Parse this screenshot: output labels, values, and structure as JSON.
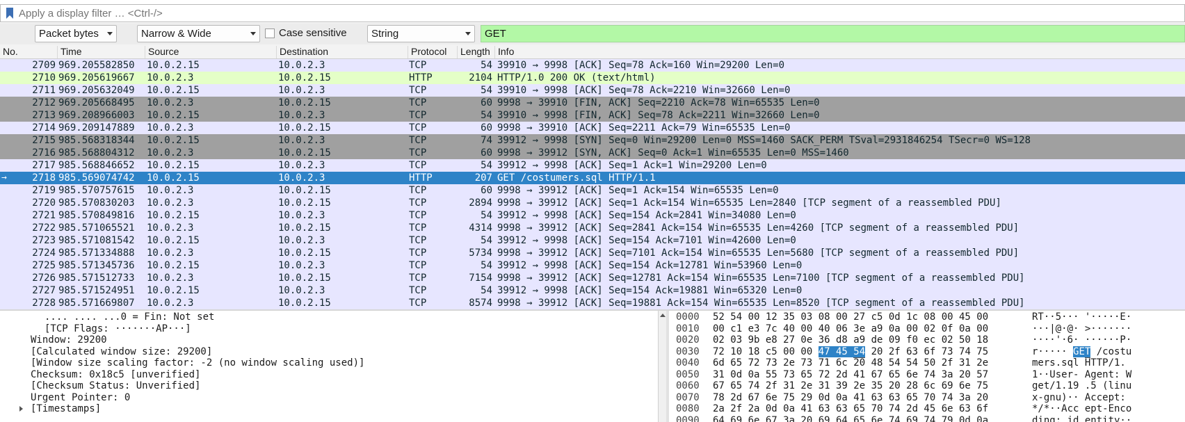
{
  "filter": {
    "placeholder": "Apply a display filter … <Ctrl-/>"
  },
  "find": {
    "search_in": "Packet bytes",
    "char_width": "Narrow & Wide",
    "case_sensitive_label": "Case sensitive",
    "search_type": "String",
    "search_value": "GET"
  },
  "packet_list": {
    "columns": [
      "No.",
      "Time",
      "Source",
      "Destination",
      "Protocol",
      "Length",
      "Info"
    ],
    "rows": [
      {
        "no": "2709",
        "time": "969.205582850",
        "src": "10.0.2.15",
        "dst": "10.0.2.3",
        "proto": "TCP",
        "len": "54",
        "info": "39910 → 9998 [ACK] Seq=78 Ack=160 Win=29200 Len=0",
        "style": "tcp"
      },
      {
        "no": "2710",
        "time": "969.205619667",
        "src": "10.0.2.3",
        "dst": "10.0.2.15",
        "proto": "HTTP",
        "len": "2104",
        "info": "HTTP/1.0 200 OK  (text/html)",
        "style": "http"
      },
      {
        "no": "2711",
        "time": "969.205632049",
        "src": "10.0.2.15",
        "dst": "10.0.2.3",
        "proto": "TCP",
        "len": "54",
        "info": "39910 → 9998 [ACK] Seq=78 Ack=2210 Win=32660 Len=0",
        "style": "tcp"
      },
      {
        "no": "2712",
        "time": "969.205668495",
        "src": "10.0.2.3",
        "dst": "10.0.2.15",
        "proto": "TCP",
        "len": "60",
        "info": "9998 → 39910 [FIN, ACK] Seq=2210 Ack=78 Win=65535 Len=0",
        "style": "gray"
      },
      {
        "no": "2713",
        "time": "969.208966003",
        "src": "10.0.2.15",
        "dst": "10.0.2.3",
        "proto": "TCP",
        "len": "54",
        "info": "39910 → 9998 [FIN, ACK] Seq=78 Ack=2211 Win=32660 Len=0",
        "style": "gray"
      },
      {
        "no": "2714",
        "time": "969.209147889",
        "src": "10.0.2.3",
        "dst": "10.0.2.15",
        "proto": "TCP",
        "len": "60",
        "info": "9998 → 39910 [ACK] Seq=2211 Ack=79 Win=65535 Len=0",
        "style": "tcp"
      },
      {
        "no": "2715",
        "time": "985.568318344",
        "src": "10.0.2.15",
        "dst": "10.0.2.3",
        "proto": "TCP",
        "len": "74",
        "info": "39912 → 9998 [SYN] Seq=0 Win=29200 Len=0 MSS=1460 SACK_PERM TSval=2931846254 TSecr=0 WS=128",
        "style": "gray"
      },
      {
        "no": "2716",
        "time": "985.568804312",
        "src": "10.0.2.3",
        "dst": "10.0.2.15",
        "proto": "TCP",
        "len": "60",
        "info": "9998 → 39912 [SYN, ACK] Seq=0 Ack=1 Win=65535 Len=0 MSS=1460",
        "style": "gray"
      },
      {
        "no": "2717",
        "time": "985.568846652",
        "src": "10.0.2.15",
        "dst": "10.0.2.3",
        "proto": "TCP",
        "len": "54",
        "info": "39912 → 9998 [ACK] Seq=1 Ack=1 Win=29200 Len=0",
        "style": "tcp"
      },
      {
        "no": "2718",
        "time": "985.569074742",
        "src": "10.0.2.15",
        "dst": "10.0.2.3",
        "proto": "HTTP",
        "len": "207",
        "info": "GET /costumers.sql HTTP/1.1",
        "style": "sel"
      },
      {
        "no": "2719",
        "time": "985.570757615",
        "src": "10.0.2.3",
        "dst": "10.0.2.15",
        "proto": "TCP",
        "len": "60",
        "info": "9998 → 39912 [ACK] Seq=1 Ack=154 Win=65535 Len=0",
        "style": "tcp"
      },
      {
        "no": "2720",
        "time": "985.570830203",
        "src": "10.0.2.3",
        "dst": "10.0.2.15",
        "proto": "TCP",
        "len": "2894",
        "info": "9998 → 39912 [ACK] Seq=1 Ack=154 Win=65535 Len=2840 [TCP segment of a reassembled PDU]",
        "style": "tcp"
      },
      {
        "no": "2721",
        "time": "985.570849816",
        "src": "10.0.2.15",
        "dst": "10.0.2.3",
        "proto": "TCP",
        "len": "54",
        "info": "39912 → 9998 [ACK] Seq=154 Ack=2841 Win=34080 Len=0",
        "style": "tcp"
      },
      {
        "no": "2722",
        "time": "985.571065521",
        "src": "10.0.2.3",
        "dst": "10.0.2.15",
        "proto": "TCP",
        "len": "4314",
        "info": "9998 → 39912 [ACK] Seq=2841 Ack=154 Win=65535 Len=4260 [TCP segment of a reassembled PDU]",
        "style": "tcp"
      },
      {
        "no": "2723",
        "time": "985.571081542",
        "src": "10.0.2.15",
        "dst": "10.0.2.3",
        "proto": "TCP",
        "len": "54",
        "info": "39912 → 9998 [ACK] Seq=154 Ack=7101 Win=42600 Len=0",
        "style": "tcp"
      },
      {
        "no": "2724",
        "time": "985.571334888",
        "src": "10.0.2.3",
        "dst": "10.0.2.15",
        "proto": "TCP",
        "len": "5734",
        "info": "9998 → 39912 [ACK] Seq=7101 Ack=154 Win=65535 Len=5680 [TCP segment of a reassembled PDU]",
        "style": "tcp"
      },
      {
        "no": "2725",
        "time": "985.571345736",
        "src": "10.0.2.15",
        "dst": "10.0.2.3",
        "proto": "TCP",
        "len": "54",
        "info": "39912 → 9998 [ACK] Seq=154 Ack=12781 Win=53960 Len=0",
        "style": "tcp"
      },
      {
        "no": "2726",
        "time": "985.571512733",
        "src": "10.0.2.3",
        "dst": "10.0.2.15",
        "proto": "TCP",
        "len": "7154",
        "info": "9998 → 39912 [ACK] Seq=12781 Ack=154 Win=65535 Len=7100 [TCP segment of a reassembled PDU]",
        "style": "tcp"
      },
      {
        "no": "2727",
        "time": "985.571524951",
        "src": "10.0.2.15",
        "dst": "10.0.2.3",
        "proto": "TCP",
        "len": "54",
        "info": "39912 → 9998 [ACK] Seq=154 Ack=19881 Win=65320 Len=0",
        "style": "tcp"
      },
      {
        "no": "2728",
        "time": "985.571669807",
        "src": "10.0.2.3",
        "dst": "10.0.2.15",
        "proto": "TCP",
        "len": "8574",
        "info": "9998 → 39912 [ACK] Seq=19881 Ack=154 Win=65535 Len=8520 [TCP segment of a reassembled PDU]",
        "style": "tcp"
      }
    ]
  },
  "details": {
    "lines": [
      {
        "text": ".... .... ...0 = Fin: Not set",
        "indent": 3,
        "expandable": false
      },
      {
        "text": "[TCP Flags: ·······AP···]",
        "indent": 3,
        "expandable": false
      },
      {
        "text": "Window: 29200",
        "indent": 2,
        "expandable": false
      },
      {
        "text": "[Calculated window size: 29200]",
        "indent": 2,
        "expandable": false
      },
      {
        "text": "[Window size scaling factor: -2 (no window scaling used)]",
        "indent": 2,
        "expandable": false
      },
      {
        "text": "Checksum: 0x18c5 [unverified]",
        "indent": 2,
        "expandable": false
      },
      {
        "text": "[Checksum Status: Unverified]",
        "indent": 2,
        "expandable": false
      },
      {
        "text": "Urgent Pointer: 0",
        "indent": 2,
        "expandable": false
      },
      {
        "text": "[Timestamps]",
        "indent": 2,
        "expandable": true
      }
    ]
  },
  "bytes": {
    "rows": [
      {
        "offset": "0000",
        "hex": "52 54 00 12 35 03 08 00  27 c5 0d 1c 08 00 45 00",
        "ascii": "RT··5··· '·····E·"
      },
      {
        "offset": "0010",
        "hex": "00 c1 e3 7c 40 00 40 06  3e a9 0a 00 02 0f 0a 00",
        "ascii": "···|@·@· >·······"
      },
      {
        "offset": "0020",
        "hex": "02 03 9b e8 27 0e 36 d8  a9 de 09 f0 ec 02 50 18",
        "ascii": "····'·6· ······P·"
      },
      {
        "offset": "0030",
        "hex_pre": "72 10 18 c5 00 00 ",
        "hex_hl": "47 45 ",
        "hex_hl2": "54",
        "hex_post": " 20 2f 63 6f 73 74 75",
        "ascii_pre": "r····· ",
        "ascii_hl": "GE",
        "ascii_hl2": "T",
        "ascii_post": " /costu"
      },
      {
        "offset": "0040",
        "hex": "6d 65 72 73 2e 73 71 6c  20 48 54 54 50 2f 31 2e",
        "ascii": "mers.sql  HTTP/1."
      },
      {
        "offset": "0050",
        "hex": "31 0d 0a 55 73 65 72 2d  41 67 65 6e 74 3a 20 57",
        "ascii": "1··User- Agent: W"
      },
      {
        "offset": "0060",
        "hex": "67 65 74 2f 31 2e 31 39  2e 35 20 28 6c 69 6e 75",
        "ascii": "get/1.19 .5 (linu"
      },
      {
        "offset": "0070",
        "hex": "78 2d 67 6e 75 29 0d 0a  41 63 63 65 70 74 3a 20",
        "ascii": "x-gnu)·· Accept: "
      },
      {
        "offset": "0080",
        "hex": "2a 2f 2a 0d 0a 41 63 63  65 70 74 2d 45 6e 63 6f",
        "ascii": "*/*··Acc ept-Enco"
      },
      {
        "offset": "0090",
        "hex": "64 69 6e 67 3a 20 69 64  65 6e 74 69 74 79 0d 0a",
        "ascii": "ding: id entity··"
      }
    ]
  }
}
